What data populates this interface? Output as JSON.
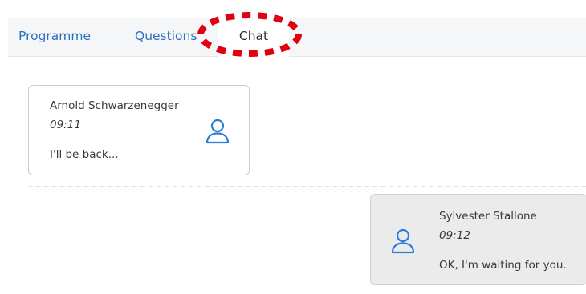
{
  "tabs": [
    {
      "label": "Programme"
    },
    {
      "label": "Questions"
    },
    {
      "label": "Chat",
      "active": true
    }
  ],
  "messages": [
    {
      "author": "Arnold Schwarzenegger",
      "time": "09:11",
      "text": "I'll be back...",
      "avatar_icon": "user-icon"
    },
    {
      "author": "Sylvester Stallone",
      "time": "09:12",
      "text": "OK, I'm waiting for you.",
      "avatar_icon": "user-icon"
    }
  ],
  "colors": {
    "tab_link": "#2b6fbe",
    "highlight": "#e0000f",
    "avatar": "#2b7fd8"
  }
}
